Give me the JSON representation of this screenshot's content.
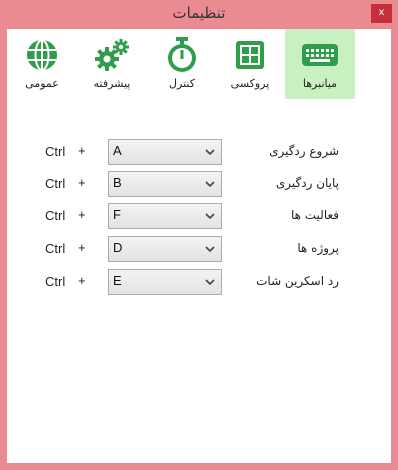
{
  "window": {
    "title": "تنظیمات",
    "close_label": "x"
  },
  "toolbar": {
    "tabs": [
      {
        "label": "میانبرها",
        "icon": "keyboard-icon",
        "active": true
      },
      {
        "label": "پروکسی",
        "icon": "proxy-grid-icon",
        "active": false
      },
      {
        "label": "کنترل",
        "icon": "stopwatch-icon",
        "active": false
      },
      {
        "label": "پیشرفته",
        "icon": "gears-icon",
        "active": false
      },
      {
        "label": "عمومی",
        "icon": "globe-icon",
        "active": false
      }
    ]
  },
  "colors": {
    "accent": "#2e9e4a",
    "active_tab": "#c8f0c0",
    "title_bar": "#ea8b91",
    "close": "#c52f3b"
  },
  "shortcuts": [
    {
      "label": "شروع ردگیری",
      "modifier": "Ctrl",
      "plus": "+",
      "key": "A"
    },
    {
      "label": "پایان ردگیری",
      "modifier": "Ctrl",
      "plus": "+",
      "key": "B"
    },
    {
      "label": "فعالیت ها",
      "modifier": "Ctrl",
      "plus": "+",
      "key": "F"
    },
    {
      "label": "پروژه ها",
      "modifier": "Ctrl",
      "plus": "+",
      "key": "D"
    },
    {
      "label": "رد اسکرین شات",
      "modifier": "Ctrl",
      "plus": "+",
      "key": "E"
    }
  ]
}
